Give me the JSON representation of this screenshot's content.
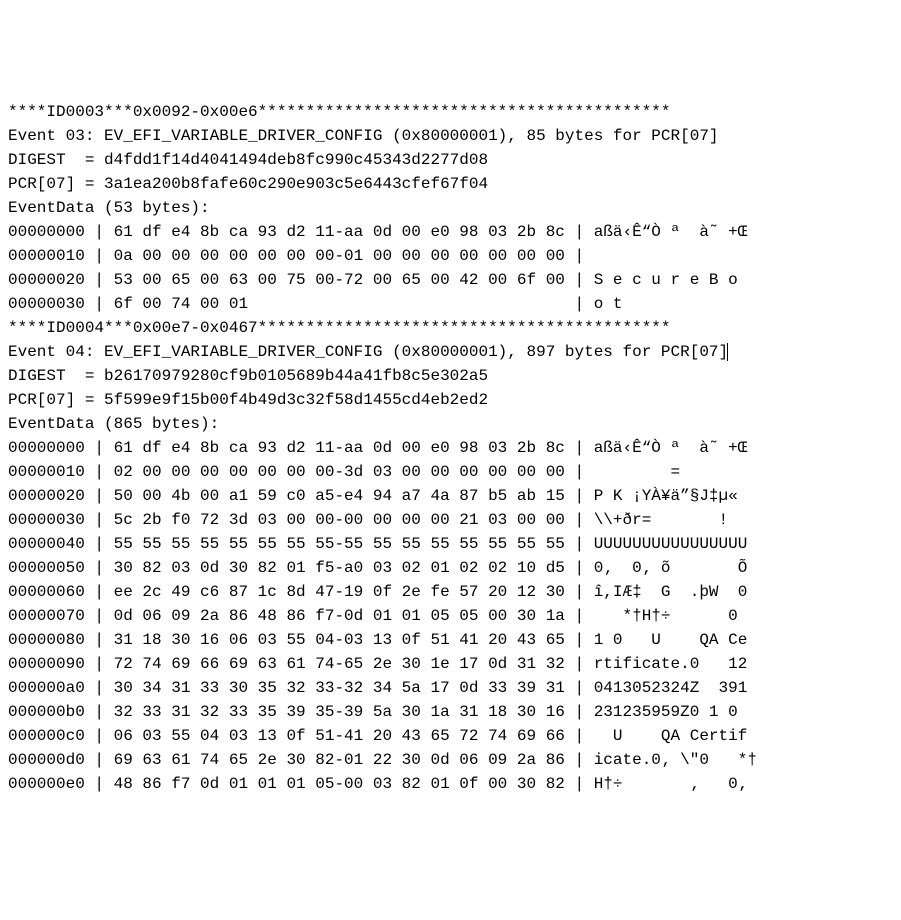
{
  "lines": [
    "****ID0003***0x0092-0x00e6*******************************************",
    "Event 03: EV_EFI_VARIABLE_DRIVER_CONFIG (0x80000001), 85 bytes for PCR[07]",
    "DIGEST  = d4fdd1f14d4041494deb8fc990c45343d2277d08",
    "PCR[07] = 3a1ea200b8fafe60c290e903c5e6443cfef67f04",
    "EventData (53 bytes):",
    "00000000 | 61 df e4 8b ca 93 d2 11-aa 0d 00 e0 98 03 2b 8c | aßä‹Ê“Ò ª  à˜ +Œ",
    "00000010 | 0a 00 00 00 00 00 00 00-01 00 00 00 00 00 00 00 |",
    "00000020 | 53 00 65 00 63 00 75 00-72 00 65 00 42 00 6f 00 | S e c u r e B o",
    "00000030 | 6f 00 74 00 01                                  | o t",
    "****ID0004***0x00e7-0x0467*******************************************",
    "Event 04: EV_EFI_VARIABLE_DRIVER_CONFIG (0x80000001), 897 bytes for PCR[07]|CURSOR|",
    "DIGEST  = b26170979280cf9b0105689b44a41fb8c5e302a5",
    "PCR[07] = 5f599e9f15b00f4b49d3c32f58d1455cd4eb2ed2",
    "EventData (865 bytes):",
    "00000000 | 61 df e4 8b ca 93 d2 11-aa 0d 00 e0 98 03 2b 8c | aßä‹Ê“Ò ª  à˜ +Œ",
    "00000010 | 02 00 00 00 00 00 00 00-3d 03 00 00 00 00 00 00 |         =",
    "00000020 | 50 00 4b 00 a1 59 c0 a5-e4 94 a7 4a 87 b5 ab 15 | P K ¡YÀ¥ä”§J‡µ«",
    "00000030 | 5c 2b f0 72 3d 03 00 00-00 00 00 00 21 03 00 00 | \\\\+ðr=       !",
    "00000040 | 55 55 55 55 55 55 55 55-55 55 55 55 55 55 55 55 | UUUUUUUUUUUUUUUU",
    "00000050 | 30 82 03 0d 30 82 01 f5-a0 03 02 01 02 02 10 d5 | 0‚  0‚ õ       Õ",
    "00000060 | ee 2c 49 c6 87 1c 8d 47-19 0f 2e fe 57 20 12 30 | î,IÆ‡  G  .þW  0",
    "00000070 | 0d 06 09 2a 86 48 86 f7-0d 01 01 05 05 00 30 1a |    *†H†÷      0",
    "00000080 | 31 18 30 16 06 03 55 04-03 13 0f 51 41 20 43 65 | 1 0   U    QA Ce",
    "00000090 | 72 74 69 66 69 63 61 74-65 2e 30 1e 17 0d 31 32 | rtificate.0   12",
    "000000a0 | 30 34 31 33 30 35 32 33-32 34 5a 17 0d 33 39 31 | 0413052324Z  391",
    "000000b0 | 32 33 31 32 33 35 39 35-39 5a 30 1a 31 18 30 16 | 231235959Z0 1 0",
    "000000c0 | 06 03 55 04 03 13 0f 51-41 20 43 65 72 74 69 66 |   U    QA Certif",
    "000000d0 | 69 63 61 74 65 2e 30 82-01 22 30 0d 06 09 2a 86 | icate.0‚ \\\"0   *†",
    "000000e0 | 48 86 f7 0d 01 01 01 05-00 03 82 01 0f 00 30 82 | H†÷       ‚   0‚"
  ]
}
